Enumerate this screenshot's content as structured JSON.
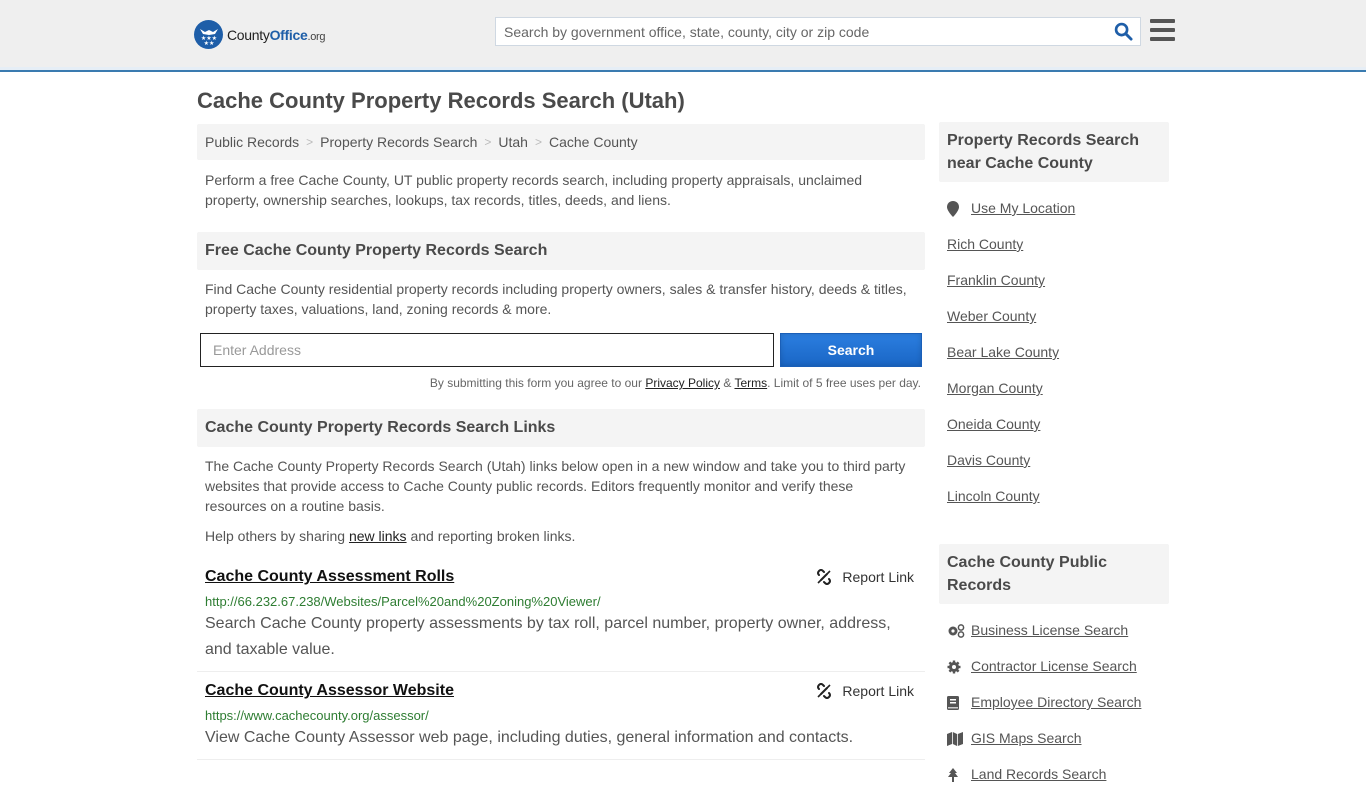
{
  "header": {
    "logo": {
      "brand_part1": "County",
      "brand_part2": "Office",
      "brand_tld": ".org"
    },
    "search": {
      "placeholder": "Search by government office, state, county, city or zip code",
      "value": ""
    },
    "icons": {
      "search": "search-icon",
      "menu": "hamburger-menu-icon"
    }
  },
  "page_title": "Cache County Property Records Search (Utah)",
  "breadcrumb": [
    {
      "label": "Public Records"
    },
    {
      "label": "Property Records Search"
    },
    {
      "label": "Utah"
    },
    {
      "label": "Cache County"
    }
  ],
  "intro": "Perform a free Cache County, UT public property records search, including property appraisals, unclaimed property, ownership searches, lookups, tax records, titles, deeds, and liens.",
  "free_search": {
    "heading": "Free Cache County Property Records Search",
    "description": "Find Cache County residential property records including property owners, sales & transfer history, deeds & titles, property taxes, valuations, land, zoning records & more.",
    "address_placeholder": "Enter Address",
    "address_value": "",
    "button_label": "Search",
    "disclaimer_prefix": "By submitting this form you agree to our ",
    "privacy_label": "Privacy Policy",
    "amp": " & ",
    "terms_label": "Terms",
    "disclaimer_suffix": ". Limit of 5 free uses per day."
  },
  "links_section": {
    "heading": "Cache County Property Records Search Links",
    "description": "The Cache County Property Records Search (Utah) links below open in a new window and take you to third party websites that provide access to Cache County public records. Editors frequently monitor and verify these resources on a routine basis.",
    "help_prefix": "Help others by sharing ",
    "help_link": "new links",
    "help_suffix": " and reporting broken links.",
    "report_label": "Report Link",
    "items": [
      {
        "title": "Cache County Assessment Rolls",
        "url": "http://66.232.67.238/Websites/Parcel%20and%20Zoning%20Viewer/",
        "description": "Search Cache County property assessments by tax roll, parcel number, property owner, address, and taxable value."
      },
      {
        "title": "Cache County Assessor Website",
        "url": "https://www.cachecounty.org/assessor/",
        "description": "View Cache County Assessor web page, including duties, general information and contacts."
      }
    ]
  },
  "sidebar": {
    "nearby": {
      "heading": "Property Records Search near Cache County",
      "use_location": "Use My Location",
      "counties": [
        "Rich County",
        "Franklin County",
        "Weber County",
        "Bear Lake County",
        "Morgan County",
        "Oneida County",
        "Davis County",
        "Lincoln County"
      ]
    },
    "public_records": {
      "heading": "Cache County Public Records",
      "items": [
        {
          "label": "Business License Search",
          "icon": "cogs-icon"
        },
        {
          "label": "Contractor License Search",
          "icon": "gear-icon"
        },
        {
          "label": "Employee Directory Search",
          "icon": "book-icon"
        },
        {
          "label": "GIS Maps Search",
          "icon": "map-icon"
        },
        {
          "label": "Land Records Search",
          "icon": "tree-icon"
        }
      ]
    }
  },
  "colors": {
    "brand_blue": "#1e5ea8",
    "header_border": "#3a7bb0",
    "button_blue": "#1a66c5",
    "url_green": "#2e7d32"
  }
}
